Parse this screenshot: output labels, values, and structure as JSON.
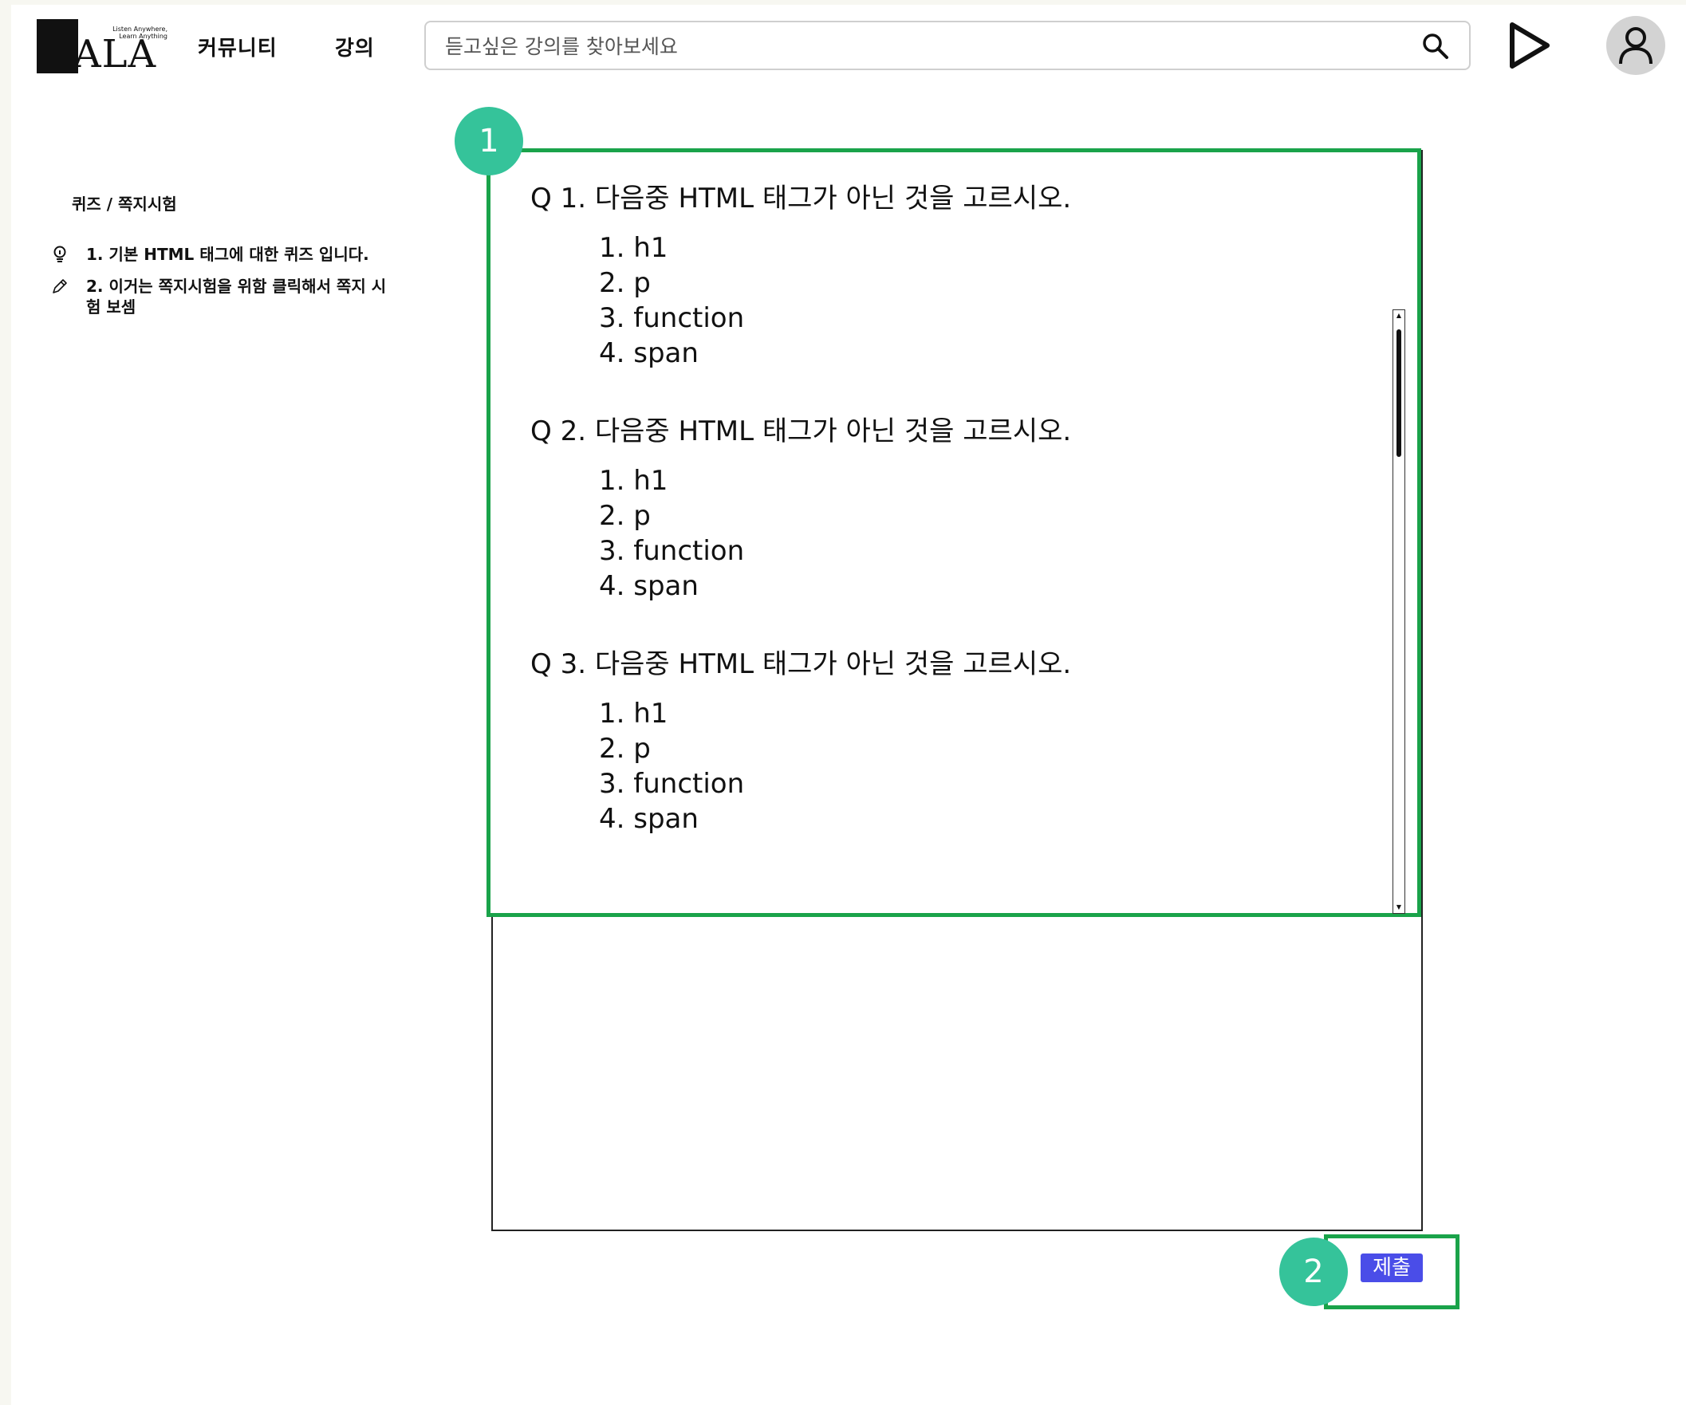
{
  "header": {
    "logo_text": "ALA",
    "logo_tagline": "Listen Anywhere, Learn Anything",
    "nav": [
      "커뮤니티",
      "강의"
    ],
    "search_placeholder": "듣고싶은 강의를 찾아보세요"
  },
  "sidebar": {
    "title": "퀴즈 / 쪽지시험",
    "items": [
      {
        "label": "1. 기본 HTML 태그에 대한 퀴즈 입니다.",
        "icon": "lightbulb-icon"
      },
      {
        "label": "2. 이거는 쪽지시험을 위함 클릭해서 쪽지 시험 보셈",
        "icon": "pencil-icon"
      }
    ]
  },
  "quiz": {
    "questions": [
      {
        "title": "Q 1. 다음중 HTML 태그가 아닌 것을 고르시오.",
        "options": [
          "1. h1",
          "2. p",
          "3. function",
          "4. span"
        ]
      },
      {
        "title": "Q 2. 다음중 HTML 태그가 아닌 것을 고르시오.",
        "options": [
          "1. h1",
          "2. p",
          "3. function",
          "4. span"
        ]
      },
      {
        "title": "Q 3. 다음중 HTML 태그가 아닌 것을 고르시오.",
        "options": [
          "1. h1",
          "2. p",
          "3. function",
          "4. span"
        ]
      }
    ],
    "submit_label": "제출"
  },
  "annotations": {
    "badge1": "1",
    "badge2": "2"
  },
  "colors": {
    "highlight_green": "#1aa34a",
    "badge_teal": "#35c39a",
    "submit_blue": "#4a4de8"
  }
}
